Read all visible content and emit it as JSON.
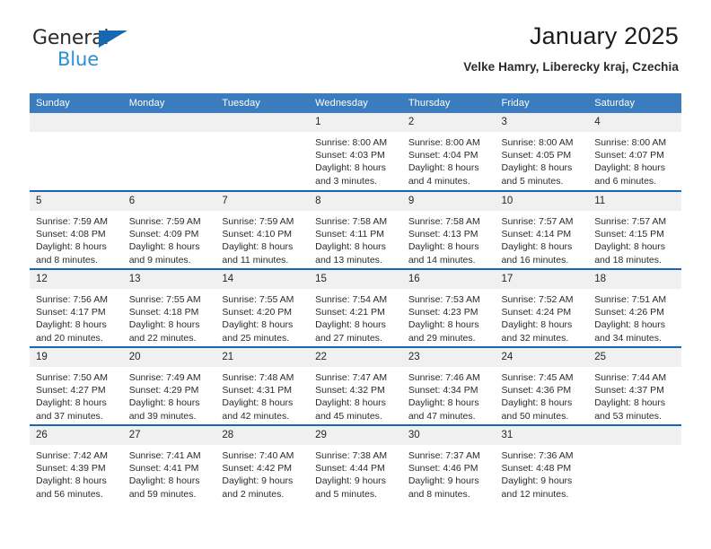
{
  "brand": {
    "line1": "General",
    "line2": "Blue",
    "triangle_color": "#1668b3",
    "blue_text_color": "#2a8fd8"
  },
  "header": {
    "title": "January 2025",
    "subtitle": "Velke Hamry, Liberecky kraj, Czechia"
  },
  "theme": {
    "header_row_bg": "#3a7cbe",
    "row_divider": "#1668b3",
    "daynum_bg": "#f0f0f0"
  },
  "weekday_headers": [
    "Sunday",
    "Monday",
    "Tuesday",
    "Wednesday",
    "Thursday",
    "Friday",
    "Saturday"
  ],
  "weeks": [
    [
      {
        "day": "",
        "lines": []
      },
      {
        "day": "",
        "lines": []
      },
      {
        "day": "",
        "lines": []
      },
      {
        "day": "1",
        "lines": [
          "Sunrise: 8:00 AM",
          "Sunset: 4:03 PM",
          "Daylight: 8 hours",
          "and 3 minutes."
        ]
      },
      {
        "day": "2",
        "lines": [
          "Sunrise: 8:00 AM",
          "Sunset: 4:04 PM",
          "Daylight: 8 hours",
          "and 4 minutes."
        ]
      },
      {
        "day": "3",
        "lines": [
          "Sunrise: 8:00 AM",
          "Sunset: 4:05 PM",
          "Daylight: 8 hours",
          "and 5 minutes."
        ]
      },
      {
        "day": "4",
        "lines": [
          "Sunrise: 8:00 AM",
          "Sunset: 4:07 PM",
          "Daylight: 8 hours",
          "and 6 minutes."
        ]
      }
    ],
    [
      {
        "day": "5",
        "lines": [
          "Sunrise: 7:59 AM",
          "Sunset: 4:08 PM",
          "Daylight: 8 hours",
          "and 8 minutes."
        ]
      },
      {
        "day": "6",
        "lines": [
          "Sunrise: 7:59 AM",
          "Sunset: 4:09 PM",
          "Daylight: 8 hours",
          "and 9 minutes."
        ]
      },
      {
        "day": "7",
        "lines": [
          "Sunrise: 7:59 AM",
          "Sunset: 4:10 PM",
          "Daylight: 8 hours",
          "and 11 minutes."
        ]
      },
      {
        "day": "8",
        "lines": [
          "Sunrise: 7:58 AM",
          "Sunset: 4:11 PM",
          "Daylight: 8 hours",
          "and 13 minutes."
        ]
      },
      {
        "day": "9",
        "lines": [
          "Sunrise: 7:58 AM",
          "Sunset: 4:13 PM",
          "Daylight: 8 hours",
          "and 14 minutes."
        ]
      },
      {
        "day": "10",
        "lines": [
          "Sunrise: 7:57 AM",
          "Sunset: 4:14 PM",
          "Daylight: 8 hours",
          "and 16 minutes."
        ]
      },
      {
        "day": "11",
        "lines": [
          "Sunrise: 7:57 AM",
          "Sunset: 4:15 PM",
          "Daylight: 8 hours",
          "and 18 minutes."
        ]
      }
    ],
    [
      {
        "day": "12",
        "lines": [
          "Sunrise: 7:56 AM",
          "Sunset: 4:17 PM",
          "Daylight: 8 hours",
          "and 20 minutes."
        ]
      },
      {
        "day": "13",
        "lines": [
          "Sunrise: 7:55 AM",
          "Sunset: 4:18 PM",
          "Daylight: 8 hours",
          "and 22 minutes."
        ]
      },
      {
        "day": "14",
        "lines": [
          "Sunrise: 7:55 AM",
          "Sunset: 4:20 PM",
          "Daylight: 8 hours",
          "and 25 minutes."
        ]
      },
      {
        "day": "15",
        "lines": [
          "Sunrise: 7:54 AM",
          "Sunset: 4:21 PM",
          "Daylight: 8 hours",
          "and 27 minutes."
        ]
      },
      {
        "day": "16",
        "lines": [
          "Sunrise: 7:53 AM",
          "Sunset: 4:23 PM",
          "Daylight: 8 hours",
          "and 29 minutes."
        ]
      },
      {
        "day": "17",
        "lines": [
          "Sunrise: 7:52 AM",
          "Sunset: 4:24 PM",
          "Daylight: 8 hours",
          "and 32 minutes."
        ]
      },
      {
        "day": "18",
        "lines": [
          "Sunrise: 7:51 AM",
          "Sunset: 4:26 PM",
          "Daylight: 8 hours",
          "and 34 minutes."
        ]
      }
    ],
    [
      {
        "day": "19",
        "lines": [
          "Sunrise: 7:50 AM",
          "Sunset: 4:27 PM",
          "Daylight: 8 hours",
          "and 37 minutes."
        ]
      },
      {
        "day": "20",
        "lines": [
          "Sunrise: 7:49 AM",
          "Sunset: 4:29 PM",
          "Daylight: 8 hours",
          "and 39 minutes."
        ]
      },
      {
        "day": "21",
        "lines": [
          "Sunrise: 7:48 AM",
          "Sunset: 4:31 PM",
          "Daylight: 8 hours",
          "and 42 minutes."
        ]
      },
      {
        "day": "22",
        "lines": [
          "Sunrise: 7:47 AM",
          "Sunset: 4:32 PM",
          "Daylight: 8 hours",
          "and 45 minutes."
        ]
      },
      {
        "day": "23",
        "lines": [
          "Sunrise: 7:46 AM",
          "Sunset: 4:34 PM",
          "Daylight: 8 hours",
          "and 47 minutes."
        ]
      },
      {
        "day": "24",
        "lines": [
          "Sunrise: 7:45 AM",
          "Sunset: 4:36 PM",
          "Daylight: 8 hours",
          "and 50 minutes."
        ]
      },
      {
        "day": "25",
        "lines": [
          "Sunrise: 7:44 AM",
          "Sunset: 4:37 PM",
          "Daylight: 8 hours",
          "and 53 minutes."
        ]
      }
    ],
    [
      {
        "day": "26",
        "lines": [
          "Sunrise: 7:42 AM",
          "Sunset: 4:39 PM",
          "Daylight: 8 hours",
          "and 56 minutes."
        ]
      },
      {
        "day": "27",
        "lines": [
          "Sunrise: 7:41 AM",
          "Sunset: 4:41 PM",
          "Daylight: 8 hours",
          "and 59 minutes."
        ]
      },
      {
        "day": "28",
        "lines": [
          "Sunrise: 7:40 AM",
          "Sunset: 4:42 PM",
          "Daylight: 9 hours",
          "and 2 minutes."
        ]
      },
      {
        "day": "29",
        "lines": [
          "Sunrise: 7:38 AM",
          "Sunset: 4:44 PM",
          "Daylight: 9 hours",
          "and 5 minutes."
        ]
      },
      {
        "day": "30",
        "lines": [
          "Sunrise: 7:37 AM",
          "Sunset: 4:46 PM",
          "Daylight: 9 hours",
          "and 8 minutes."
        ]
      },
      {
        "day": "31",
        "lines": [
          "Sunrise: 7:36 AM",
          "Sunset: 4:48 PM",
          "Daylight: 9 hours",
          "and 12 minutes."
        ]
      },
      {
        "day": "",
        "lines": []
      }
    ]
  ]
}
